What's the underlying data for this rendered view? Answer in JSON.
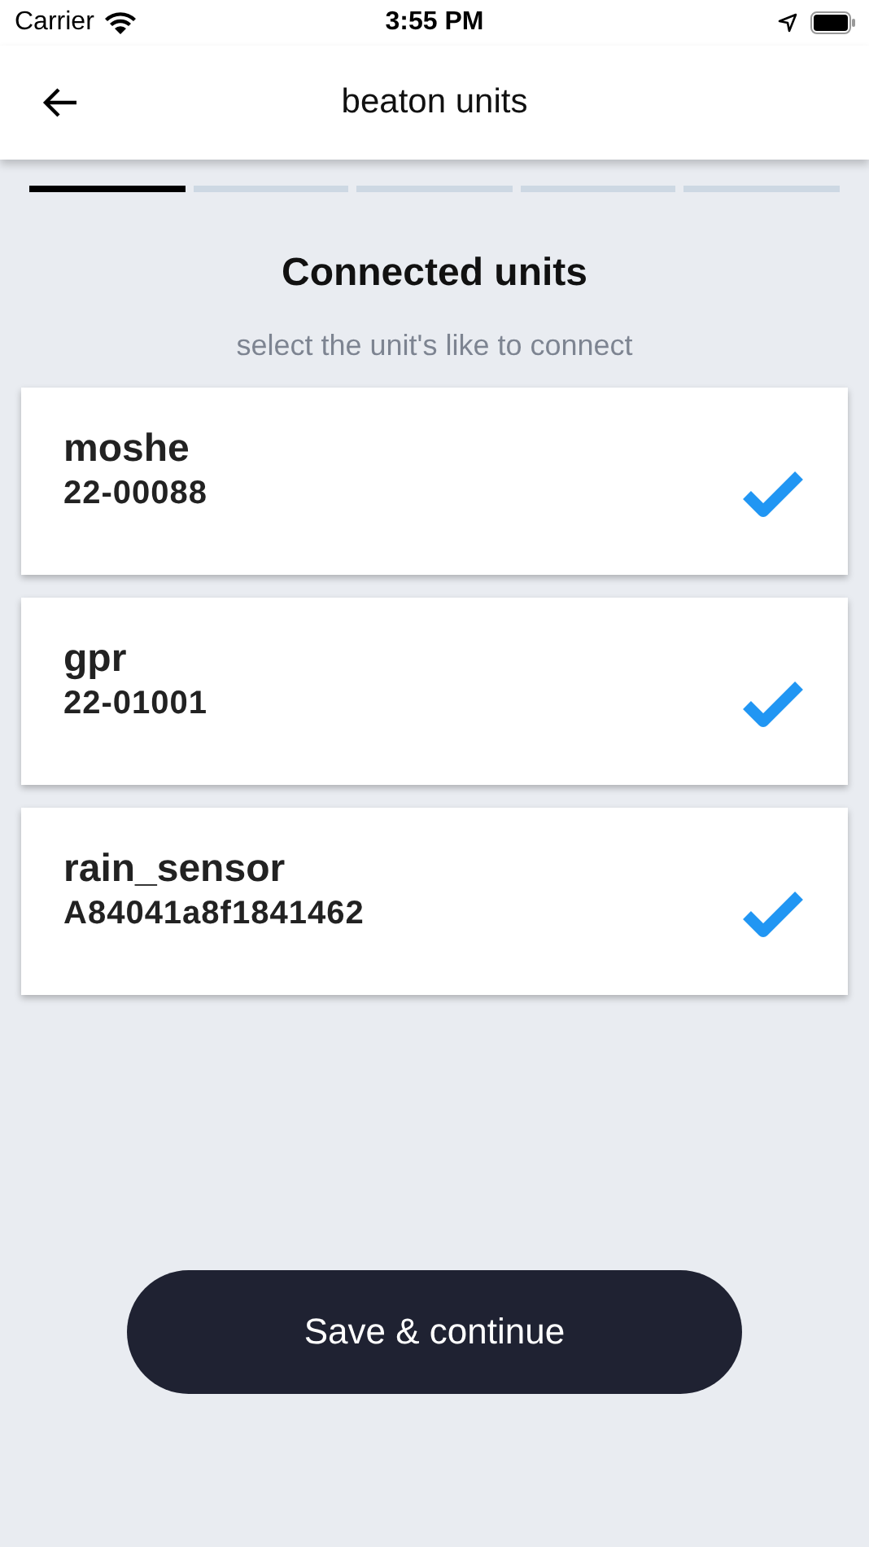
{
  "status_bar": {
    "carrier": "Carrier",
    "time": "3:55 PM"
  },
  "nav": {
    "title": "beaton units"
  },
  "steps": [
    {
      "active": true
    },
    {
      "active": false
    },
    {
      "active": false
    },
    {
      "active": false
    },
    {
      "active": false
    }
  ],
  "heading": "Connected units",
  "subtitle": "select the unit's  like to connect",
  "units": [
    {
      "name": "moshe",
      "id": "22-00088",
      "checked": true
    },
    {
      "name": "gpr",
      "id": "22-01001",
      "checked": true
    },
    {
      "name": "rain_sensor",
      "id": "A84041a8f1841462",
      "checked": true
    }
  ],
  "button": "Save & continue"
}
